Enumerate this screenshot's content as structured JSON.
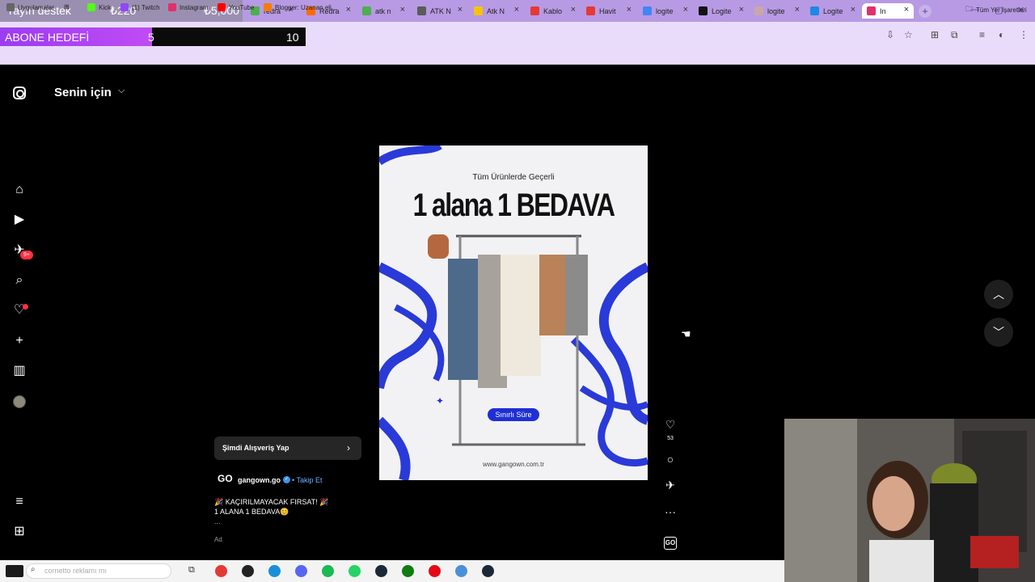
{
  "stream_overlay": {
    "donation_label": "Yayın destek",
    "donation_current": "₺220",
    "donation_goal": "₺5,000",
    "sub_goal_label": "ABONE HEDEFİ",
    "sub_goal_current": "5",
    "sub_goal_max": "10",
    "sub_goal_fraction": 0.5
  },
  "browser": {
    "tabs": [
      {
        "label": "redra",
        "color": "#4caf50"
      },
      {
        "label": "Redra",
        "color": "#ff6a00"
      },
      {
        "label": "atk n",
        "color": "#4caf50"
      },
      {
        "label": "ATK N",
        "color": "#5b5b5b"
      },
      {
        "label": "Atk N",
        "color": "#f5c400"
      },
      {
        "label": "Kablo",
        "color": "#e53935"
      },
      {
        "label": "Havit",
        "color": "#e53935"
      },
      {
        "label": "logite",
        "color": "#4285f4"
      },
      {
        "label": "Logite",
        "color": "#111111"
      },
      {
        "label": "logite",
        "color": "#c9a7a7"
      },
      {
        "label": "Logite",
        "color": "#1e88e5"
      },
      {
        "label": "In",
        "color": "#e1306c"
      }
    ],
    "bookmarks": [
      {
        "label": "Uygulamalar",
        "icon": "apps-icon",
        "color": "#666666"
      },
      {
        "label": "Kick",
        "icon": "kick-icon",
        "color": "#53fc18"
      },
      {
        "label": "(1) Twitch",
        "icon": "twitch-icon",
        "color": "#9146ff"
      },
      {
        "label": "Instagram",
        "icon": "instagram-icon",
        "color": "#e1306c"
      },
      {
        "label": "YouTube",
        "icon": "youtube-icon",
        "color": "#ff0000"
      },
      {
        "label": "Blogger: Uzanan eli...",
        "icon": "blogger-icon",
        "color": "#f57d00"
      }
    ],
    "all_bookmarks": "Tüm Yer İşaretleri"
  },
  "instagram": {
    "feed_title": "Senin için",
    "nav_badge": "9+",
    "ad": {
      "subtitle": "Tüm Ürünlerde Geçerli",
      "headline": "1 alana 1 BEDAVA",
      "button": "Sınırlı Süre",
      "url": "www.gangown.com.tr"
    },
    "likes": "53",
    "shop_label": "Şimdi Alışveriş Yap",
    "account_logo": "GO",
    "account": "gangown.go",
    "follow": "• Takip Et",
    "caption_line1": "🎉 KAÇIRILMAYACAK FIRSAT! 🎉",
    "caption_line2": "1 ALANA 1 BEDAVA😊",
    "caption_more": "...",
    "ad_label": "Ad",
    "audio_logo": "GO"
  },
  "taskbar": {
    "search_text": "cornetto reklamı mı",
    "search_label": "Ara"
  }
}
